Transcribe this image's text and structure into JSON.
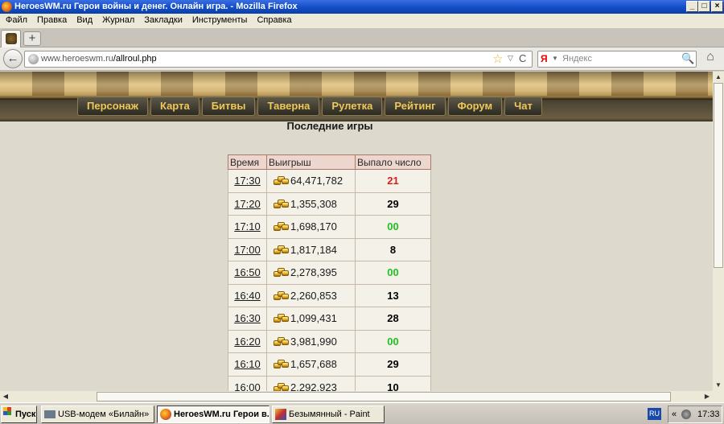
{
  "window": {
    "title": "HeroesWM.ru Герои войны и денег. Онлайн игра. - Mozilla Firefox",
    "min": "_",
    "max": "□",
    "close": "×"
  },
  "menu": [
    "Файл",
    "Правка",
    "Вид",
    "Журнал",
    "Закладки",
    "Инструменты",
    "Справка"
  ],
  "tabs": {
    "new_tab": "+"
  },
  "nav": {
    "back": "←",
    "url_host": "www.heroeswm.ru",
    "url_path": "/allroul.php",
    "star": "☆",
    "dropdown": "▽",
    "reload": "C",
    "search_engine": "Я",
    "search_placeholder": "Яндекс",
    "search": "🔍",
    "home": "⌂"
  },
  "site_nav": [
    "Персонаж",
    "Карта",
    "Битвы",
    "Таверна",
    "Рулетка",
    "Рейтинг",
    "Форум",
    "Чат"
  ],
  "page": {
    "heading": "Последние игры",
    "columns": [
      "Время",
      "Выигрыш",
      "Выпало число"
    ],
    "rows": [
      {
        "time": "17:30",
        "win": "64,471,782",
        "number": "21",
        "color": "#d42020",
        "group_end": false
      },
      {
        "time": "17:20",
        "win": "1,355,308",
        "number": "29",
        "color": "#000000",
        "group_end": false
      },
      {
        "time": "17:10",
        "win": "1,698,170",
        "number": "00",
        "color": "#23c023",
        "group_end": true
      },
      {
        "time": "17:00",
        "win": "1,817,184",
        "number": "8",
        "color": "#000000",
        "group_end": false
      },
      {
        "time": "16:50",
        "win": "2,278,395",
        "number": "00",
        "color": "#23c023",
        "group_end": false
      },
      {
        "time": "16:40",
        "win": "2,260,853",
        "number": "13",
        "color": "#000000",
        "group_end": false
      },
      {
        "time": "16:30",
        "win": "1,099,431",
        "number": "28",
        "color": "#000000",
        "group_end": false
      },
      {
        "time": "16:20",
        "win": "3,981,990",
        "number": "00",
        "color": "#23c023",
        "group_end": true
      },
      {
        "time": "16:10",
        "win": "1,657,688",
        "number": "29",
        "color": "#000000",
        "group_end": false
      },
      {
        "time": "16:00",
        "win": "2,292,923",
        "number": "10",
        "color": "#000000",
        "group_end": false
      }
    ]
  },
  "taskbar": {
    "start": "Пуск",
    "tasks": [
      "USB-модем «Билайн»",
      "HeroesWM.ru Герои в...",
      "Безымянный - Paint"
    ],
    "lang": "RU",
    "tray_arrow": "«",
    "clock": "17:33"
  }
}
